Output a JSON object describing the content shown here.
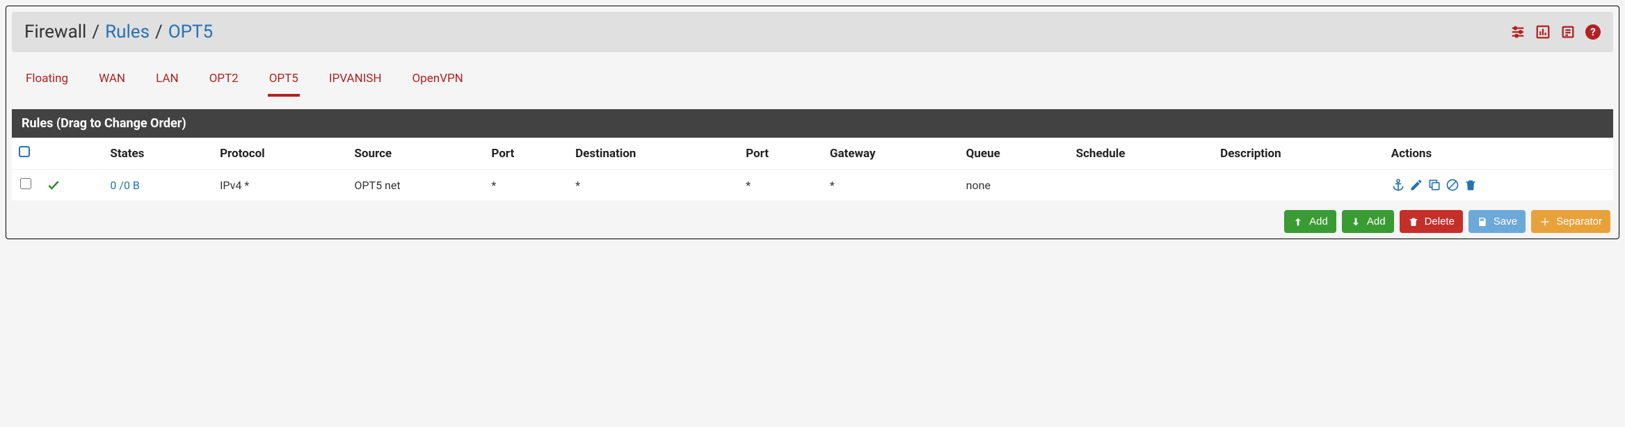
{
  "breadcrumb": {
    "root": "Firewall",
    "link": "Rules",
    "current": "OPT5"
  },
  "tabs": [
    {
      "label": "Floating",
      "active": false
    },
    {
      "label": "WAN",
      "active": false
    },
    {
      "label": "LAN",
      "active": false
    },
    {
      "label": "OPT2",
      "active": false
    },
    {
      "label": "OPT5",
      "active": true
    },
    {
      "label": "IPVANISH",
      "active": false
    },
    {
      "label": "OpenVPN",
      "active": false
    }
  ],
  "rules_panel": {
    "title": "Rules (Drag to Change Order)"
  },
  "columns": {
    "states": "States",
    "protocol": "Protocol",
    "source": "Source",
    "port_src": "Port",
    "destination": "Destination",
    "port_dst": "Port",
    "gateway": "Gateway",
    "queue": "Queue",
    "schedule": "Schedule",
    "description": "Description",
    "actions": "Actions"
  },
  "rows": [
    {
      "states": "0 /0 B",
      "protocol": "IPv4 *",
      "source": "OPT5 net",
      "port_src": "*",
      "destination": "*",
      "port_dst": "*",
      "gateway": "*",
      "queue": "none",
      "schedule": "",
      "description": ""
    }
  ],
  "buttons": {
    "add_top": "Add",
    "add_bottom": "Add",
    "delete": "Delete",
    "save": "Save",
    "separator": "Separator"
  }
}
